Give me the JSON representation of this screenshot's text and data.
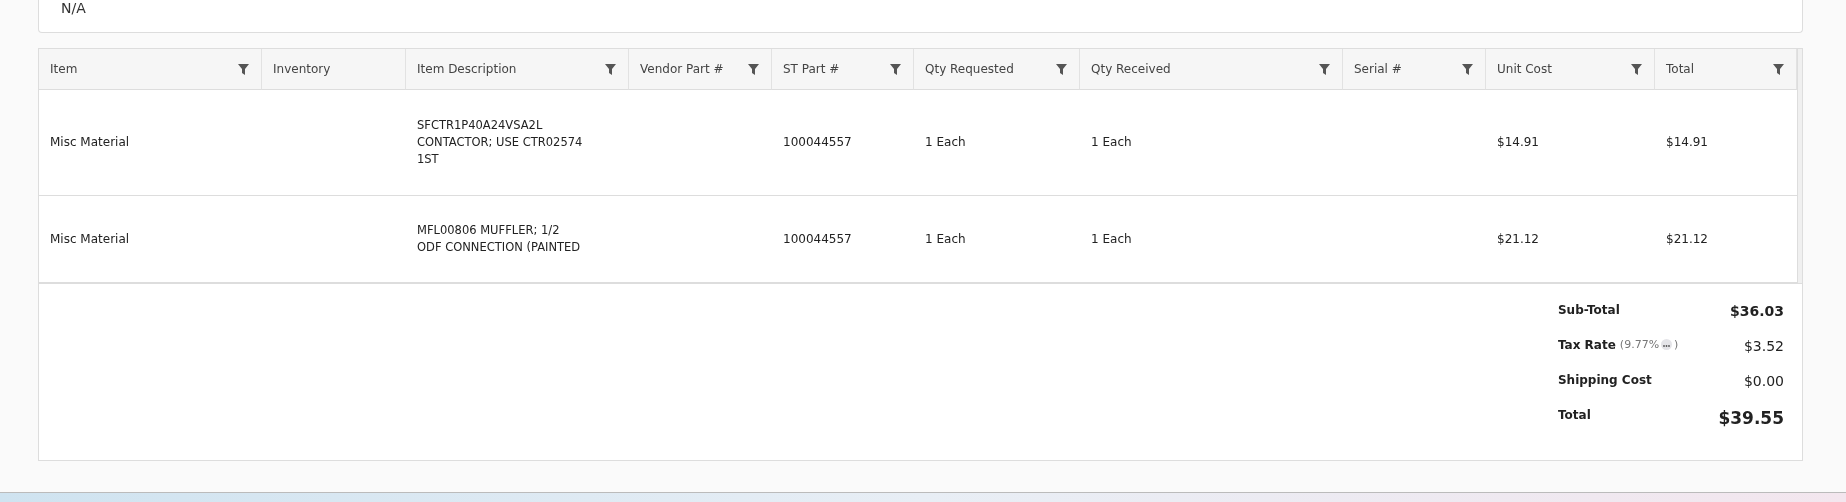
{
  "top_card": {
    "value": "N/A"
  },
  "table": {
    "columns": [
      {
        "label": "Item",
        "filterable": true
      },
      {
        "label": "Inventory",
        "filterable": false
      },
      {
        "label": "Item Description",
        "filterable": true
      },
      {
        "label": "Vendor Part #",
        "filterable": true
      },
      {
        "label": "ST Part #",
        "filterable": true
      },
      {
        "label": "Qty Requested",
        "filterable": true
      },
      {
        "label": "Qty Received",
        "filterable": true
      },
      {
        "label": "Serial #",
        "filterable": true
      },
      {
        "label": "Unit Cost",
        "filterable": true
      },
      {
        "label": "Total",
        "filterable": true
      }
    ],
    "rows": [
      [
        "Misc Material",
        "",
        "SFCTR1P40A24VSA2L CONTACTOR; USE CTR02574 1ST",
        "",
        "100044557",
        "1 Each",
        "1 Each",
        "",
        "$14.91",
        "$14.91"
      ],
      [
        "Misc Material",
        "",
        "MFL00806 MUFFLER; 1/2 ODF CONNECTION (PAINTED",
        "",
        "100044557",
        "1 Each",
        "1 Each",
        "",
        "$21.12",
        "$21.12"
      ]
    ]
  },
  "summary": {
    "sub_total": {
      "label": "Sub-Total",
      "value": "$36.03"
    },
    "tax": {
      "label": "Tax Rate",
      "detail_open": "(9.77%",
      "detail_close": ")",
      "value": "$3.52"
    },
    "shipping": {
      "label": "Shipping Cost",
      "value": "$0.00"
    },
    "total": {
      "label": "Total",
      "value": "$39.55"
    }
  }
}
